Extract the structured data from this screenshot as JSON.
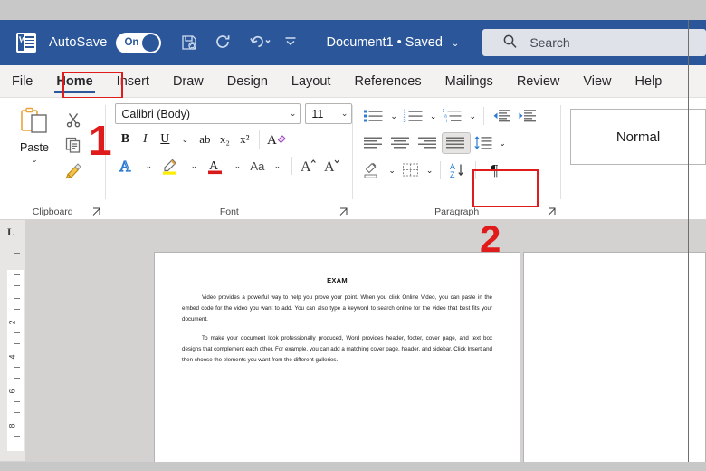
{
  "app": {
    "name": "Microsoft Word",
    "accent_color": "#2b579a",
    "annotation_color": "#e01b1b"
  },
  "titlebar": {
    "logo_letter": "W",
    "autosave_label": "AutoSave",
    "autosave_state": "On",
    "document_title": "Document1 • Saved",
    "title_chevron": "⌄",
    "quick_access": [
      {
        "name": "save-icon",
        "tooltip": "Save"
      },
      {
        "name": "redo-circle-icon",
        "tooltip": "Repeat"
      },
      {
        "name": "undo-icon",
        "tooltip": "Undo"
      },
      {
        "name": "customize-quick-access-icon",
        "tooltip": "Customize Quick Access Toolbar"
      }
    ]
  },
  "search": {
    "placeholder": "Search",
    "icon": "search-icon"
  },
  "tabs": [
    {
      "label": "File",
      "active": false
    },
    {
      "label": "Home",
      "active": true
    },
    {
      "label": "Insert",
      "active": false
    },
    {
      "label": "Draw",
      "active": false
    },
    {
      "label": "Design",
      "active": false
    },
    {
      "label": "Layout",
      "active": false
    },
    {
      "label": "References",
      "active": false
    },
    {
      "label": "Mailings",
      "active": false
    },
    {
      "label": "Review",
      "active": false
    },
    {
      "label": "View",
      "active": false
    },
    {
      "label": "Help",
      "active": false
    }
  ],
  "ribbon": {
    "clipboard": {
      "group_label": "Clipboard",
      "paste_label": "Paste",
      "paste_chevron": "⌄",
      "buttons": [
        {
          "name": "cut-icon",
          "label": "Cut"
        },
        {
          "name": "copy-icon",
          "label": "Copy"
        },
        {
          "name": "format-painter-icon",
          "label": "Format Painter"
        }
      ],
      "dialog_launcher": "⌐"
    },
    "font": {
      "group_label": "Font",
      "font_name": "Calibri (Body)",
      "font_size": "11",
      "dropdown_chevron": "⌄",
      "row_bold_italic": [
        {
          "name": "bold-button",
          "label": "B"
        },
        {
          "name": "italic-button",
          "label": "I"
        },
        {
          "name": "underline-button",
          "label": "U"
        },
        {
          "name": "strikethrough-button",
          "label": "ab"
        },
        {
          "name": "subscript-button",
          "label": "x₂"
        },
        {
          "name": "superscript-button",
          "label": "x²"
        },
        {
          "name": "clear-formatting-button",
          "label": "A"
        }
      ],
      "row_effects": [
        {
          "name": "text-effects-button",
          "label": "A"
        },
        {
          "name": "text-highlight-color-button",
          "label": "highlight"
        },
        {
          "name": "font-color-button",
          "label": "A"
        },
        {
          "name": "change-case-button",
          "label": "Aa"
        },
        {
          "name": "grow-font-button",
          "label": "A"
        },
        {
          "name": "shrink-font-button",
          "label": "A"
        }
      ],
      "highlight_color": "#ffee00",
      "font_color": "#d81a1a",
      "dialog_launcher": "⌐"
    },
    "paragraph": {
      "group_label": "Paragraph",
      "row1": [
        {
          "name": "bullets-button",
          "label": "Bullets"
        },
        {
          "name": "numbering-button",
          "label": "Numbering"
        },
        {
          "name": "multilevel-list-button",
          "label": "Multilevel List"
        },
        {
          "name": "decrease-indent-button",
          "label": "Decrease Indent"
        },
        {
          "name": "increase-indent-button",
          "label": "Increase Indent"
        }
      ],
      "row2": [
        {
          "name": "align-left-button",
          "label": "Align Left",
          "active": false
        },
        {
          "name": "align-center-button",
          "label": "Center",
          "active": false
        },
        {
          "name": "align-right-button",
          "label": "Align Right",
          "active": false
        },
        {
          "name": "justify-button",
          "label": "Justify",
          "active": true
        },
        {
          "name": "line-spacing-button",
          "label": "Line and Paragraph Spacing",
          "active": false
        }
      ],
      "row3": [
        {
          "name": "shading-button",
          "label": "Shading"
        },
        {
          "name": "borders-button",
          "label": "Borders"
        },
        {
          "name": "sort-button",
          "label": "Sort"
        },
        {
          "name": "show-hide-formatting-marks-button",
          "label": "¶"
        }
      ],
      "dialog_launcher": "⌐"
    },
    "styles": {
      "normal_style": "Normal"
    }
  },
  "annotations": [
    {
      "id": "1",
      "label": "1",
      "target": "Home tab"
    },
    {
      "id": "2",
      "label": "2",
      "target": "Show/Hide formatting marks button"
    }
  ],
  "ruler": {
    "tab_stop_marker": "L",
    "numbers": [
      "2",
      "4",
      "6",
      "8"
    ]
  },
  "document": {
    "heading": "EXAM",
    "paragraphs": [
      "Video provides a powerful way to help you prove your point. When you click Online Video, you can paste in the embed code for the video you want to add. You can also type a keyword to search online for the video that best fits your document.",
      "To make your document look professionally produced, Word provides header, footer, cover page, and text box designs that complement each other. For example, you can add a matching cover page, header, and sidebar. Click Insert and then choose the elements you want from the different galleries."
    ]
  }
}
